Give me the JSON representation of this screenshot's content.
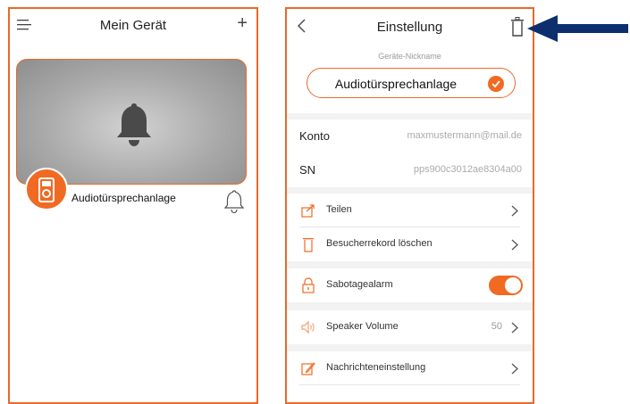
{
  "left_screen": {
    "title": "Mein Gerät",
    "device_name": "Audiotürsprechanlage"
  },
  "right_screen": {
    "title": "Einstellung",
    "nickname_label": "Geräte-Nickname",
    "nickname_value": "Audiotürsprechanlage",
    "account_rows": [
      {
        "label": "Konto",
        "value": "maxmustermann@mail.de"
      },
      {
        "label": "SN",
        "value": "pps900c3012ae8304a00"
      }
    ],
    "menu": {
      "share": "Teilen",
      "delete_records": "Besucherrekord löschen",
      "tamper_alarm": "Sabotagealarm",
      "speaker_volume": "Speaker Volume",
      "speaker_volume_value": "50",
      "notification_settings": "Nachrichteneinstellung"
    },
    "tamper_alarm_enabled": true
  },
  "colors": {
    "accent": "#e8692a",
    "badge": "#f06a23",
    "annotation_arrow": "#0d2f6e"
  },
  "icons": [
    "menu-icon",
    "plus-icon",
    "bell-icon",
    "device-icon",
    "bell-outline-icon",
    "back-icon",
    "trash-icon",
    "check-icon",
    "share-icon",
    "lock-icon",
    "speaker-icon",
    "edit-icon",
    "chevron-right-icon"
  ]
}
